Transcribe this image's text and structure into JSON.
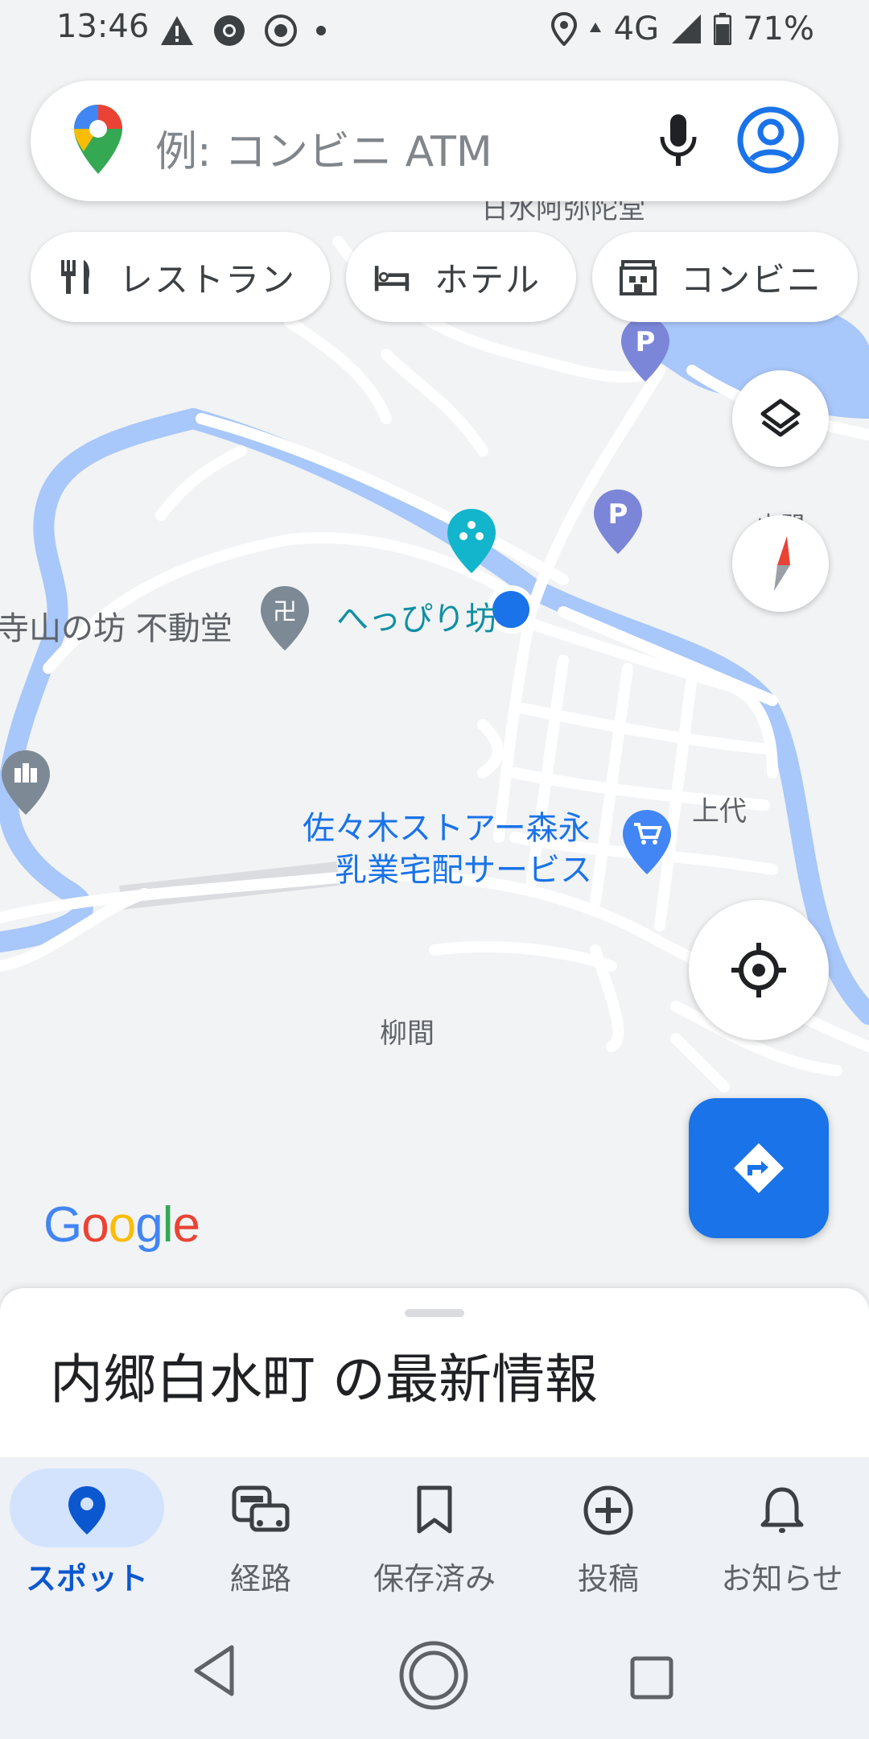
{
  "status_bar": {
    "time": "13:46",
    "left_icons": [
      "warning-icon",
      "chrome-icon",
      "game-controller-icon",
      "dot-icon"
    ],
    "network": "4G",
    "battery": "71%"
  },
  "search": {
    "placeholder": "例: コンビニ ATM"
  },
  "chips": [
    {
      "label": "レストラン",
      "icon": "fork-knife-icon"
    },
    {
      "label": "ホテル",
      "icon": "bed-icon"
    },
    {
      "label": "コンビニ",
      "icon": "store-icon"
    }
  ],
  "map": {
    "labels": {
      "place_temple": "寺山の坊 不動堂",
      "place_heppiri": "へっぴり坊",
      "store_line1": "佐々木ストアー森永",
      "store_line2": "乳業宅配サービス",
      "kamishiro": "上代",
      "yanagima": "柳間",
      "top_partial": "日水阿弥陀堂",
      "right_partial": "山門"
    },
    "parking_label": "P"
  },
  "attribution": {
    "letters": [
      "G",
      "o",
      "o",
      "g",
      "l",
      "e"
    ],
    "colors": [
      "#4285f4",
      "#ea4335",
      "#fbbc05",
      "#4285f4",
      "#34a853",
      "#ea4335"
    ]
  },
  "sheet": {
    "title": "内郷白水町 の最新情報"
  },
  "bottom_nav": [
    {
      "label": "スポット",
      "icon": "location-pin-icon",
      "active": true
    },
    {
      "label": "経路",
      "icon": "commute-icon",
      "active": false
    },
    {
      "label": "保存済み",
      "icon": "bookmark-icon",
      "active": false
    },
    {
      "label": "投稿",
      "icon": "add-circle-icon",
      "active": false
    },
    {
      "label": "お知らせ",
      "icon": "bell-icon",
      "active": false
    }
  ],
  "colors": {
    "accent": "#1a73e8",
    "water": "#a8c7fa",
    "road": "#ffffff",
    "map_bg": "#f1f3f4",
    "parking": "#7b86d9",
    "teal": "#12b5cb"
  }
}
